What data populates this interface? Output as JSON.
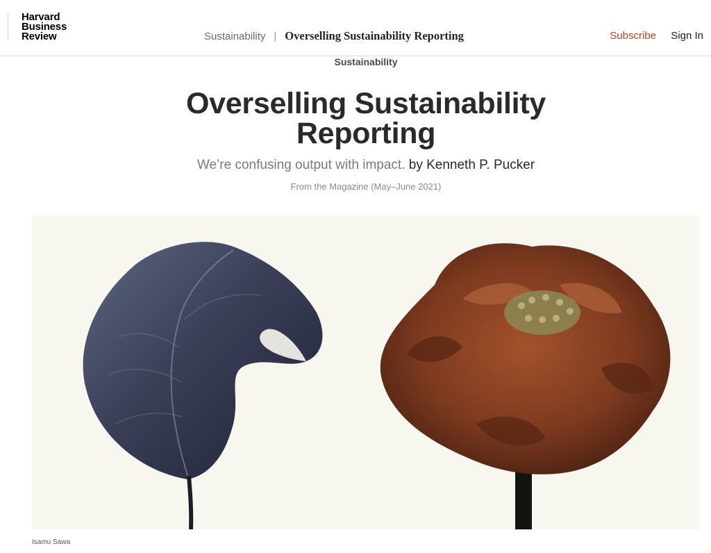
{
  "header": {
    "logo_lines": [
      "Harvard",
      "Business",
      "Review"
    ],
    "breadcrumb": {
      "section": "Sustainability",
      "separator": "|",
      "article": "Overselling Sustainability Reporting"
    },
    "subscribe_label": "Subscribe",
    "signin_label": "Sign In"
  },
  "article": {
    "topic": "Sustainability",
    "title_line1": "Overselling Sustainability",
    "title_line2": "Reporting",
    "dek": "We’re confusing output with impact.",
    "byline_prefix": "by",
    "author": "Kenneth P. Pucker",
    "issue": "From the Magazine (May–June 2021)"
  },
  "hero": {
    "left_subject": "dried-leaf",
    "right_subject": "dried-flower",
    "background_color": "#f7f6ef",
    "credit": "Isamu Sawa"
  },
  "colors": {
    "accent": "#c8401c",
    "text": "#2a2a2a",
    "muted": "#7a7a7a"
  }
}
